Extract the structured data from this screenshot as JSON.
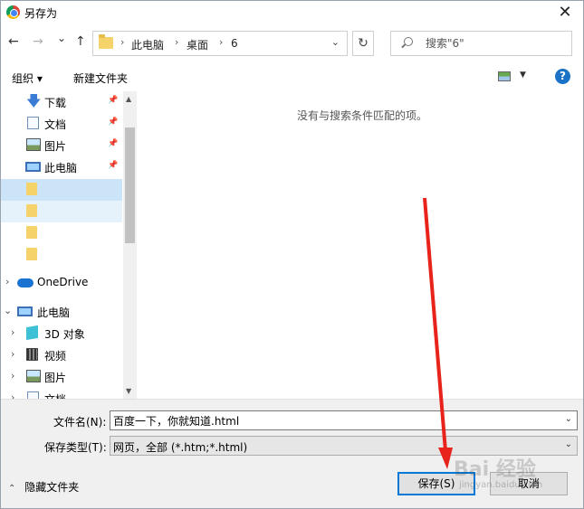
{
  "window": {
    "title": "另存为",
    "close": "✕"
  },
  "nav": {
    "back": "←",
    "forward": "→",
    "recent": "⌄",
    "up": "↑",
    "breadcrumbs": [
      "此电脑",
      "桌面",
      "6"
    ],
    "refresh": "↻",
    "search_placeholder": "搜索\"6\""
  },
  "commands": {
    "organize": "组织 ▾",
    "new_folder": "新建文件夹",
    "view_dd": "▼",
    "help": "?"
  },
  "sidebar": {
    "quick": [
      {
        "label": "下载",
        "icon": "download-icon",
        "pinned": true
      },
      {
        "label": "文档",
        "icon": "document-icon",
        "pinned": true
      },
      {
        "label": "图片",
        "icon": "pictures-icon",
        "pinned": true
      },
      {
        "label": "此电脑",
        "icon": "computer-icon",
        "pinned": true
      }
    ],
    "onedrive": "OneDrive",
    "this_pc": "此电脑",
    "pc_items": [
      {
        "label": "3D 对象",
        "icon": "3d-objects-icon"
      },
      {
        "label": "视频",
        "icon": "video-icon"
      },
      {
        "label": "图片",
        "icon": "pictures-icon"
      },
      {
        "label": "文档",
        "icon": "document-icon"
      }
    ]
  },
  "content": {
    "empty_message": "没有与搜索条件匹配的项。"
  },
  "form": {
    "filename_label": "文件名(N):",
    "filename_value": "百度一下，你就知道.html",
    "filetype_label": "保存类型(T):",
    "filetype_value": "网页，全部 (*.htm;*.html)"
  },
  "footer": {
    "hide_folders": "隐藏文件夹",
    "save": "保存(S)",
    "cancel": "取消"
  },
  "watermark": {
    "brand": "Bai 经验",
    "url": "jingyan.baidu.com"
  },
  "colors": {
    "accent": "#0078d7",
    "selection": "#cce4f7",
    "annotation": "#e8231b"
  }
}
